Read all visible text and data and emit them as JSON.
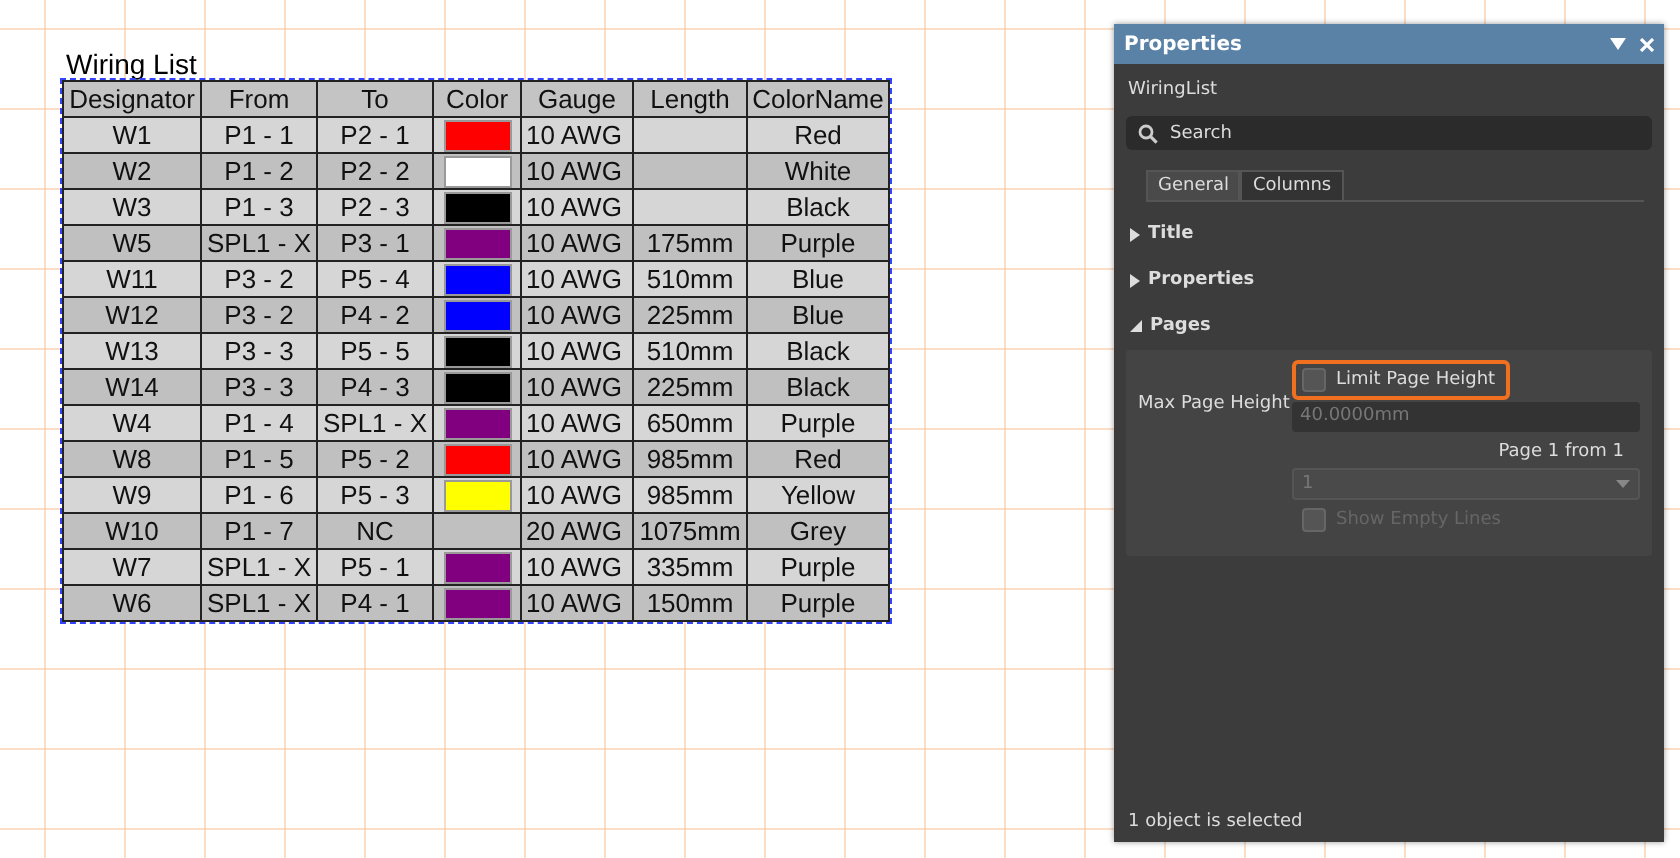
{
  "wiring_list": {
    "title": "Wiring List",
    "columns": [
      "Designator",
      "From",
      "To",
      "Color",
      "Gauge",
      "Length",
      "ColorName"
    ],
    "rows": [
      {
        "designator": "W1",
        "from": "P1 - 1",
        "to": "P2 - 1",
        "color": "#ff0000",
        "gauge": "10 AWG",
        "color_name": "Red"
      },
      {
        "designator": "W2",
        "from": "P1 - 2",
        "to": "P2 - 2",
        "color": "#ffffff",
        "gauge": "10 AWG",
        "color_name": "White"
      },
      {
        "designator": "W3",
        "from": "P1 - 3",
        "to": "P2 - 3",
        "color": "#000000",
        "gauge": "10 AWG",
        "color_name": "Black"
      },
      {
        "designator": "W5",
        "from": "SPL1 - X",
        "to": "P3 - 1",
        "color": "#800080",
        "gauge": "10 AWG",
        "length": "175mm",
        "color_name": "Purple"
      },
      {
        "designator": "W11",
        "from": "P3 - 2",
        "to": "P5 - 4",
        "color": "#0000ff",
        "gauge": "10 AWG",
        "length": "510mm",
        "color_name": "Blue"
      },
      {
        "designator": "W12",
        "from": "P3 - 2",
        "to": "P4 - 2",
        "color": "#0000ff",
        "gauge": "10 AWG",
        "length": "225mm",
        "color_name": "Blue"
      },
      {
        "designator": "W13",
        "from": "P3 - 3",
        "to": "P5 - 5",
        "color": "#000000",
        "gauge": "10 AWG",
        "length": "510mm",
        "color_name": "Black"
      },
      {
        "designator": "W14",
        "from": "P3 - 3",
        "to": "P4 - 3",
        "color": "#000000",
        "gauge": "10 AWG",
        "length": "225mm",
        "color_name": "Black"
      },
      {
        "designator": "W4",
        "from": "P1 - 4",
        "to": "SPL1 - X",
        "color": "#800080",
        "gauge": "10 AWG",
        "length": "650mm",
        "color_name": "Purple"
      },
      {
        "designator": "W8",
        "from": "P1 - 5",
        "to": "P5 - 2",
        "color": "#ff0000",
        "gauge": "10 AWG",
        "length": "985mm",
        "color_name": "Red"
      },
      {
        "designator": "W9",
        "from": "P1 - 6",
        "to": "P5 - 3",
        "color": "#ffff00",
        "gauge": "10 AWG",
        "length": "985mm",
        "color_name": "Yellow"
      },
      {
        "designator": "W10",
        "from": "P1 - 7",
        "to": "NC",
        "gauge": "20 AWG",
        "length": "1075mm",
        "color_name": "Grey"
      },
      {
        "designator": "W7",
        "from": "SPL1 - X",
        "to": "P5 - 1",
        "color": "#800080",
        "gauge": "10 AWG",
        "length": "335mm",
        "color_name": "Purple"
      },
      {
        "designator": "W6",
        "from": "SPL1 - X",
        "to": "P4 - 1",
        "color": "#800080",
        "gauge": "10 AWG",
        "length": "150mm",
        "color_name": "Purple"
      }
    ]
  },
  "properties_panel": {
    "title": "Properties",
    "object_name": "WiringList",
    "search": {
      "placeholder": "Search"
    },
    "tabs": [
      {
        "label": "General",
        "selected": true
      },
      {
        "label": "Columns",
        "selected": false
      }
    ],
    "sections": [
      {
        "label": "Title",
        "expanded": false
      },
      {
        "label": "Properties",
        "expanded": false
      },
      {
        "label": "Pages",
        "expanded": true
      }
    ],
    "pages": {
      "max_page_height_label": "Max Page Height",
      "limit_page_height": {
        "label": "Limit Page Height",
        "checked": false,
        "highlighted": true
      },
      "max_page_height": {
        "value": "40.0000mm",
        "disabled": true
      },
      "page_info": "Page 1 from 1",
      "page_select": {
        "value": "1",
        "disabled": true
      },
      "show_empty_lines": {
        "label": "Show Empty Lines",
        "checked": false,
        "disabled": true
      }
    },
    "status": "1 object is selected"
  }
}
